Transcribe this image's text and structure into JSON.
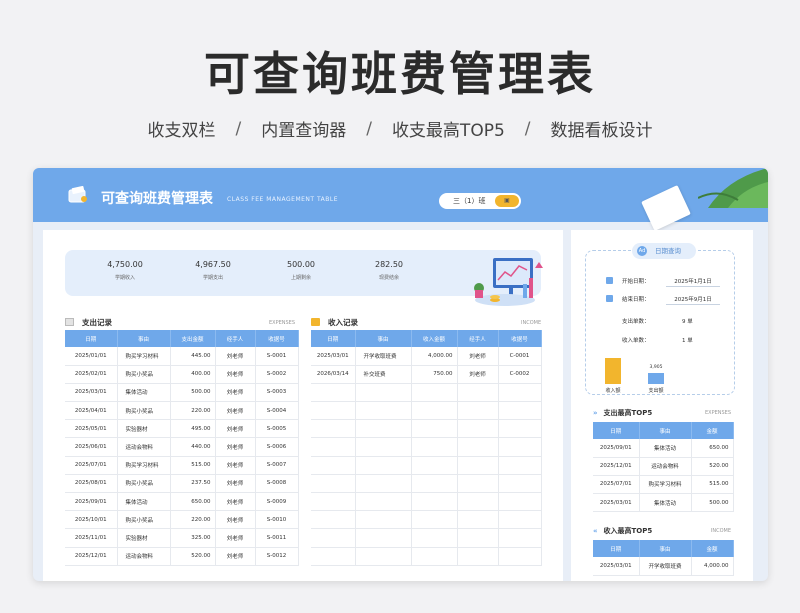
{
  "poster": {
    "title": "可查询班费管理表",
    "subtitle_items": [
      "收支双栏",
      "内置查询器",
      "收支最高TOP5",
      "数据看板设计"
    ],
    "separator": "/"
  },
  "header": {
    "title": "可查询班费管理表",
    "subtitle_en": "CLASS FEE MANAGEMENT TABLE",
    "class_selector": "三（1）班",
    "toggle_label": "",
    "accent_color": "#6fa8ea"
  },
  "stats": [
    {
      "value": "4,750.00",
      "label": "学期收入"
    },
    {
      "value": "4,967.50",
      "label": "学期支出"
    },
    {
      "value": "500.00",
      "label": "上期剩余"
    },
    {
      "value": "282.50",
      "label": "现费结余"
    }
  ],
  "expenses": {
    "title": "支出记录",
    "title_en": "EXPENSES",
    "columns": [
      "日期",
      "事由",
      "支出金额",
      "经手人",
      "收据号"
    ],
    "rows": [
      [
        "2025/01/01",
        "购买学习材料",
        "445.00",
        "刘老师",
        "S-0001"
      ],
      [
        "2025/02/01",
        "购买小奖品",
        "400.00",
        "刘老师",
        "S-0002"
      ],
      [
        "2025/03/01",
        "集体活动",
        "500.00",
        "刘老师",
        "S-0003"
      ],
      [
        "2025/04/01",
        "购买小奖品",
        "220.00",
        "刘老师",
        "S-0004"
      ],
      [
        "2025/05/01",
        "实验器材",
        "495.00",
        "刘老师",
        "S-0005"
      ],
      [
        "2025/06/01",
        "运动会物料",
        "440.00",
        "刘老师",
        "S-0006"
      ],
      [
        "2025/07/01",
        "购买学习材料",
        "515.00",
        "刘老师",
        "S-0007"
      ],
      [
        "2025/08/01",
        "购买小奖品",
        "237.50",
        "刘老师",
        "S-0008"
      ],
      [
        "2025/09/01",
        "集体活动",
        "650.00",
        "刘老师",
        "S-0009"
      ],
      [
        "2025/10/01",
        "购买小奖品",
        "220.00",
        "刘老师",
        "S-0010"
      ],
      [
        "2025/11/01",
        "实验器材",
        "325.00",
        "刘老师",
        "S-0011"
      ],
      [
        "2025/12/01",
        "运动会物料",
        "520.00",
        "刘老师",
        "S-0012"
      ]
    ]
  },
  "income": {
    "title": "收入记录",
    "title_en": "INCOME",
    "columns": [
      "日期",
      "事由",
      "收入金额",
      "经手人",
      "收据号"
    ],
    "rows": [
      [
        "2025/03/01",
        "开学收取班费",
        "4,000.00",
        "刘老师",
        "C-0001"
      ],
      [
        "2026/03/14",
        "补交班费",
        "750.00",
        "刘老师",
        "C-0002"
      ],
      [
        "",
        "",
        "",
        "",
        ""
      ],
      [
        "",
        "",
        "",
        "",
        ""
      ],
      [
        "",
        "",
        "",
        "",
        ""
      ],
      [
        "",
        "",
        "",
        "",
        ""
      ],
      [
        "",
        "",
        "",
        "",
        ""
      ],
      [
        "",
        "",
        "",
        "",
        ""
      ],
      [
        "",
        "",
        "",
        "",
        ""
      ],
      [
        "",
        "",
        "",
        "",
        ""
      ],
      [
        "",
        "",
        "",
        "",
        ""
      ],
      [
        "",
        "",
        "",
        "",
        ""
      ]
    ]
  },
  "query": {
    "title": "日期查询",
    "icon_text": "Ad",
    "start_label": "开始日期：",
    "start_value": "2025年1月1日",
    "end_label": "结束日期：",
    "end_value": "2025年9月1日",
    "expense_count_label": "支出单数：",
    "expense_count": "9 单",
    "income_count_label": "收入单数：",
    "income_count": "1 单",
    "bars": [
      {
        "label": "收入额",
        "value": 4000,
        "value_text": "",
        "color": "#f2b52d"
      },
      {
        "label": "支出额",
        "value": 3905,
        "value_text": "3,905",
        "color": "#6fa8ea"
      }
    ]
  },
  "top5_expense": {
    "title": "支出最高TOP5",
    "title_en": "EXPENSES",
    "columns": [
      "日期",
      "事由",
      "金额"
    ],
    "rows": [
      [
        "2025/09/01",
        "集体活动",
        "650.00"
      ],
      [
        "2025/12/01",
        "运动会物料",
        "520.00"
      ],
      [
        "2025/07/01",
        "购买学习材料",
        "515.00"
      ],
      [
        "2025/03/01",
        "集体活动",
        "500.00"
      ]
    ]
  },
  "top5_income": {
    "title": "收入最高TOP5",
    "title_en": "INCOME",
    "columns": [
      "日期",
      "事由",
      "金额"
    ],
    "rows": [
      [
        "2025/03/01",
        "开学收取班费",
        "4,000.00"
      ]
    ]
  }
}
